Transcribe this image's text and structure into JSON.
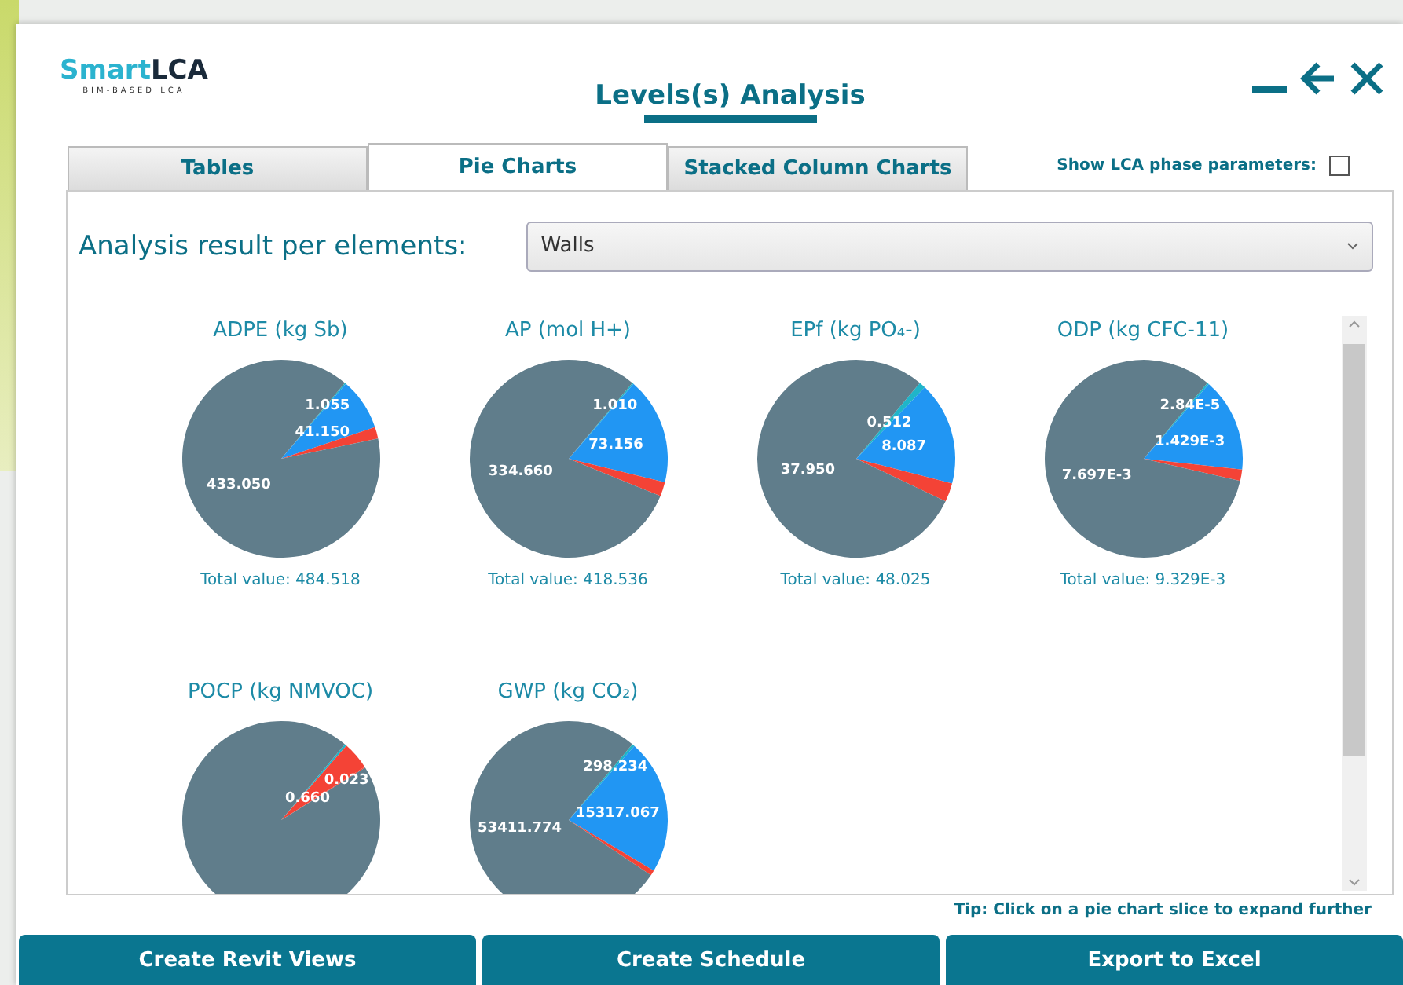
{
  "logo": {
    "brand_light": "Smart",
    "brand_bold": "LCA",
    "tagline": "BIM-BASED LCA"
  },
  "window": {
    "title": "Levels(s) Analysis"
  },
  "tabs": [
    {
      "label": "Tables",
      "selected": false
    },
    {
      "label": "Pie Charts",
      "selected": true
    },
    {
      "label": "Stacked Column Charts",
      "selected": false
    }
  ],
  "phase_toggle": {
    "label": "Show LCA phase parameters:",
    "checked": false
  },
  "filter": {
    "label": "Analysis result per elements:",
    "value": "Walls"
  },
  "charts": [
    {
      "title": "ADPE (kg Sb)",
      "total": "Total value: 484.518",
      "chart_data": {
        "type": "pie",
        "values": [
          1.055,
          41.15,
          9.263,
          433.05
        ],
        "colors": [
          "#1fb5c9",
          "#2196f3",
          "#f44336",
          "#607d8b"
        ],
        "value_labels": [
          "1.055",
          "41.150",
          null,
          "433.050"
        ]
      }
    },
    {
      "title": "AP (mol H+)",
      "total": "Total value: 418.536",
      "chart_data": {
        "type": "pie",
        "values": [
          1.01,
          73.156,
          9.71,
          334.66
        ],
        "colors": [
          "#1fb5c9",
          "#2196f3",
          "#f44336",
          "#607d8b"
        ],
        "value_labels": [
          "1.010",
          "73.156",
          null,
          "334.660"
        ]
      }
    },
    {
      "title": "EPf (kg PO₄-)",
      "total": "Total value: 48.025",
      "chart_data": {
        "type": "pie",
        "values": [
          0.512,
          8.087,
          1.476,
          37.95
        ],
        "colors": [
          "#1fb5c9",
          "#2196f3",
          "#f44336",
          "#607d8b"
        ],
        "value_labels": [
          "0.512",
          "8.087",
          null,
          "37.950"
        ]
      }
    },
    {
      "title": "ODP (kg CFC-11)",
      "total": "Total value: 9.329E-3",
      "chart_data": {
        "type": "pie",
        "values": [
          2.84e-05,
          0.001429,
          0.000175,
          0.007697
        ],
        "colors": [
          "#1fb5c9",
          "#2196f3",
          "#f44336",
          "#607d8b"
        ],
        "value_labels": [
          "2.84E-5",
          "1.429E-3",
          null,
          "7.697E-3"
        ]
      }
    },
    {
      "title": "POCP (kg NMVOC)",
      "chart_data": {
        "type": "pie",
        "values": [
          0.05,
          0.66,
          0.023,
          13.9
        ],
        "colors": [
          "#1fb5c9",
          "#f44336",
          "#f44336",
          "#607d8b"
        ],
        "value_labels": [
          null,
          "0.660",
          "0.023",
          null
        ]
      }
    },
    {
      "title": "GWP (kg CO₂)",
      "chart_data": {
        "type": "pie",
        "values": [
          298.234,
          15317.067,
          600,
          53411.774
        ],
        "colors": [
          "#1fb5c9",
          "#2196f3",
          "#f44336",
          "#607d8b"
        ],
        "value_labels": [
          "298.234",
          "15317.067",
          null,
          "53411.774"
        ]
      }
    }
  ],
  "tip": "Tip: Click on a pie chart slice to expand further",
  "buttons": [
    "Create Revit Views",
    "Create Schedule",
    "Export to Excel"
  ]
}
